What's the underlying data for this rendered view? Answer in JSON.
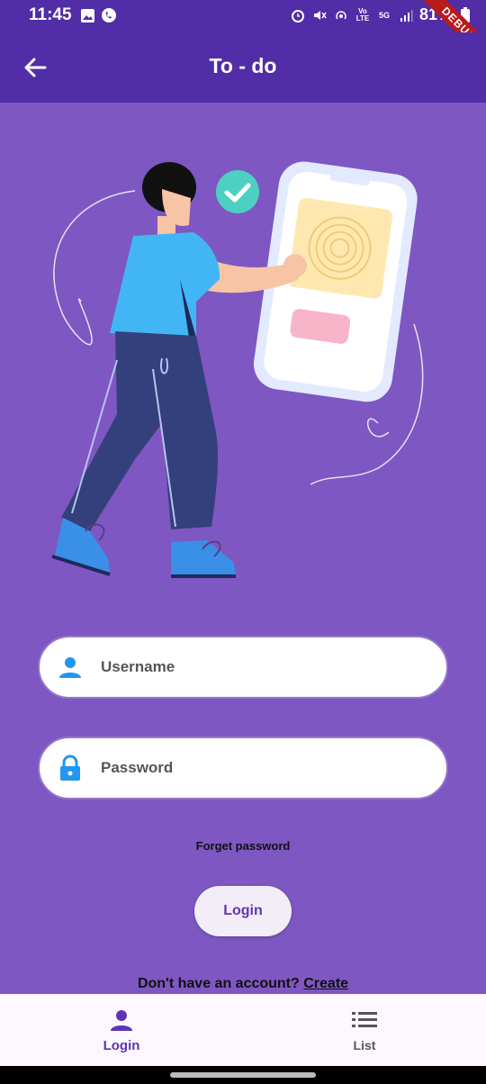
{
  "status_bar": {
    "time": "11:45",
    "battery": "81%",
    "left_icons": [
      "image-icon",
      "whatsapp-icon"
    ],
    "right_icons": [
      "alarm-icon",
      "mute-icon",
      "hotspot-icon",
      "volte-icon",
      "5g-icon",
      "signal-icon",
      "battery-icon"
    ],
    "network": "5G"
  },
  "debug_banner": "DEBUG",
  "app_bar": {
    "title": "To - do",
    "back_icon": "arrow-back-icon"
  },
  "illustration": {
    "description_icon": "fingerprint-login-illustration"
  },
  "form": {
    "username_placeholder": "Username",
    "password_placeholder": "Password",
    "username_icon": "person-icon",
    "password_icon": "lock-icon",
    "forget_password": "Forget password",
    "login_button": "Login",
    "signup_prompt": "Don't have an account?",
    "signup_link": "Create"
  },
  "bottom_nav": {
    "items": [
      {
        "label": "Login",
        "icon": "person-icon",
        "active": true
      },
      {
        "label": "List",
        "icon": "list-icon",
        "active": false
      }
    ]
  },
  "colors": {
    "primary": "#512DA8",
    "background": "#7E57C2",
    "accent_icon": "#2196F3"
  }
}
